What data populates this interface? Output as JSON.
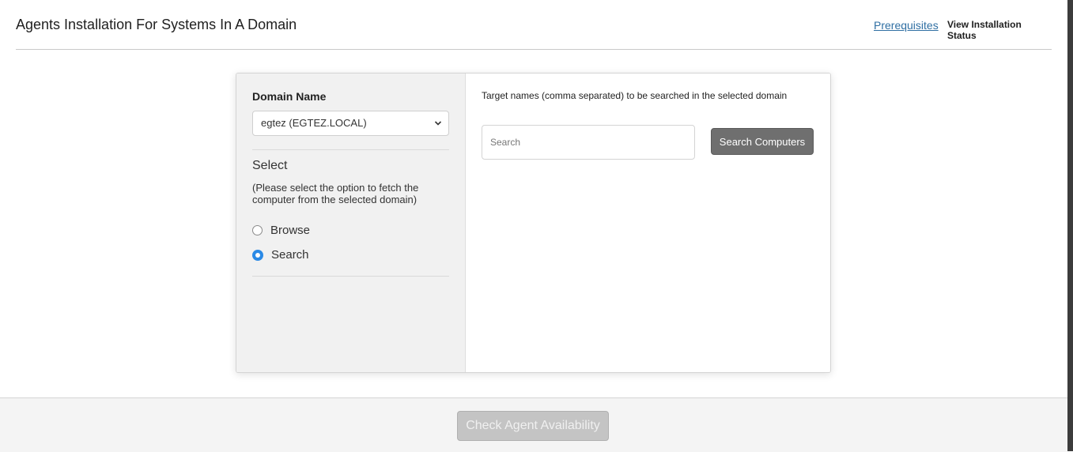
{
  "header": {
    "title": "Agents Installation For Systems In A Domain",
    "prerequisites_link": "Prerequisites",
    "view_status_link": "View Installation Status"
  },
  "left_pane": {
    "domain_label": "Domain Name",
    "domain_selected": "egtez (EGTEZ.LOCAL)",
    "select_heading": "Select",
    "select_help": "(Please select the option to fetch the computer from the selected domain)",
    "options": [
      {
        "label": "Browse",
        "checked": false
      },
      {
        "label": "Search",
        "checked": true
      }
    ]
  },
  "right_pane": {
    "target_label": "Target names (comma separated) to be searched in the selected domain",
    "search_placeholder": "Search",
    "search_button": "Search Computers"
  },
  "footer": {
    "check_button": "Check Agent Availability",
    "check_button_disabled": true
  },
  "colors": {
    "link": "#2f6fa3",
    "radio_checked": "#2b8ae6",
    "primary_button": "#6f6f6f",
    "disabled_button": "#c4c4c4"
  },
  "icons": {
    "select_arrow": "chevron-down-icon"
  }
}
